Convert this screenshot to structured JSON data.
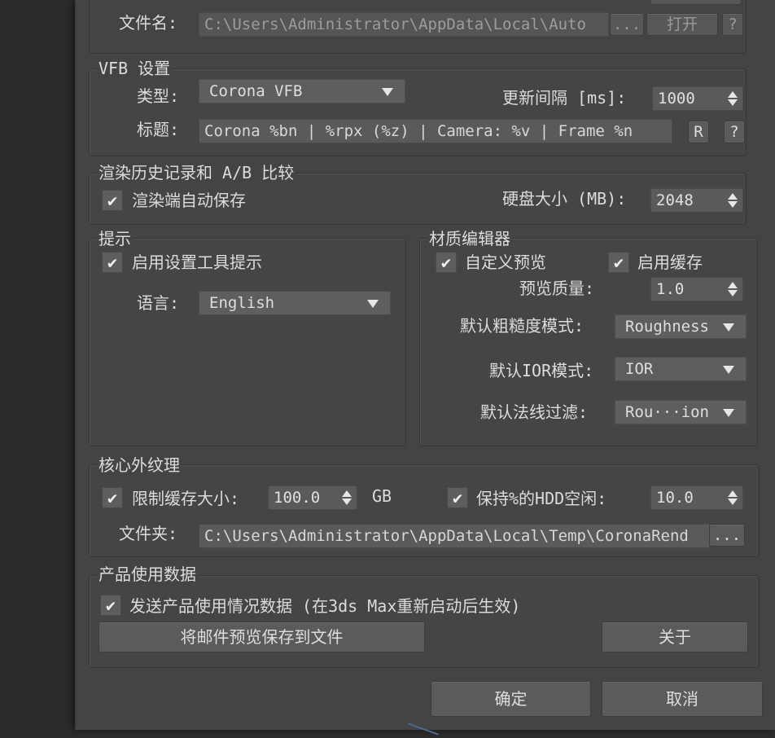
{
  "file": {
    "label": "文件名:",
    "path": "C:\\Users\\Administrator\\AppData\\Local\\Auto",
    "browse": "...",
    "open": "打开",
    "help": "?"
  },
  "vfb": {
    "title": "VFB 设置",
    "type_label": "类型:",
    "type_value": "Corona VFB",
    "interval_label": "更新间隔 [ms]:",
    "interval_value": "1000",
    "caption_label": "标题:",
    "caption_value": "Corona %bn | %rpx (%z) | Camera: %v | Frame %n",
    "r_button": "R",
    "help": "?"
  },
  "history": {
    "title": "渲染历史记录和 A/B 比较",
    "autosave_label": "渲染端自动保存",
    "autosave_checked": true,
    "disk_label": "硬盘大小 (MB):",
    "disk_value": "2048"
  },
  "tips": {
    "title": "提示",
    "enable_label": "启用设置工具提示",
    "enable_checked": true,
    "lang_label": "语言:",
    "lang_value": "English"
  },
  "material": {
    "title": "材质编辑器",
    "custom_preview_label": "自定义预览",
    "custom_preview_checked": true,
    "cache_label": "启用缓存",
    "cache_checked": true,
    "quality_label": "预览质量:",
    "quality_value": "1.0",
    "roughness_label": "默认粗糙度模式:",
    "roughness_value": "Roughness",
    "ior_label": "默认IOR模式:",
    "ior_value": "IOR",
    "normal_label": "默认法线过滤:",
    "normal_value": "Rou···ion"
  },
  "ooc": {
    "title": "核心外纹理",
    "limit_label": "限制缓存大小:",
    "limit_checked": true,
    "limit_value": "100.0",
    "limit_unit": "GB",
    "keep_label": "保持%的HDD空闲:",
    "keep_checked": true,
    "keep_value": "10.0",
    "folder_label": "文件夹:",
    "folder_value": "C:\\Users\\Administrator\\AppData\\Local\\Temp\\CoronaRend",
    "browse": "..."
  },
  "usage": {
    "title": "产品使用数据",
    "send_label": "发送产品使用情况数据 (在3ds Max重新启动后生效)",
    "send_checked": true,
    "save_preview": "将邮件预览保存到文件",
    "about": "关于"
  },
  "footer": {
    "ok": "确定",
    "cancel": "取消"
  },
  "colors": {
    "dialog_bg": "#444444",
    "field_bg": "#5a5a5a",
    "text": "#dcdcdc"
  }
}
